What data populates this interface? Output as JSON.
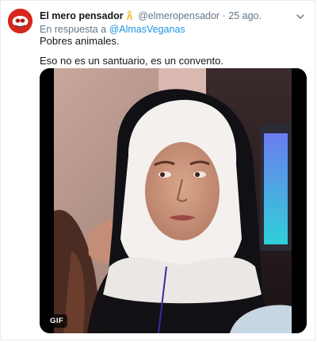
{
  "tweet": {
    "author_name": "El mero pensador",
    "author_handle": "@elmeropensador",
    "separator": "·",
    "time": "25 ago.",
    "reply_prefix": "En respuesta a",
    "reply_to": "@AlmasVeganas",
    "text_line1": "Pobres animales.",
    "text_line2": "Eso no es un santuario, es un convento.",
    "media_badge": "GIF"
  },
  "icons": {
    "avatar": "avatar-logo-icon",
    "ribbon": "awareness-ribbon-icon",
    "caret": "chevron-down-icon"
  },
  "colors": {
    "link": "#1b95e0",
    "secondary_text": "#657786",
    "primary_text": "#14171a",
    "avatar_bg": "#d7261e",
    "ribbon": "#f5c242"
  }
}
